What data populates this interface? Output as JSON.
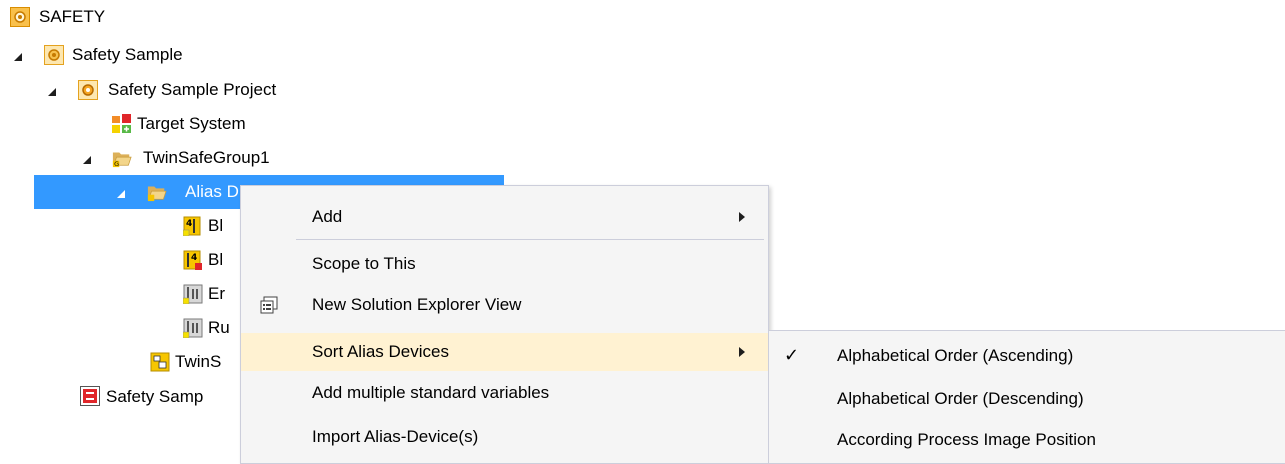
{
  "tree": {
    "root": "SAFETY",
    "safety_sample": "Safety Sample",
    "safety_sample_project": "Safety Sample Project",
    "target_system": "Target System",
    "twinsafe_group": "TwinSafeGroup1",
    "alias_devices": "Alias D",
    "child1": "Bl",
    "child2": "Bl",
    "child3": "Er",
    "child4": "Ru",
    "twins": "TwinS",
    "safety_samp": "Safety Samp"
  },
  "context_menu": {
    "add": "Add",
    "scope_to_this": "Scope to This",
    "new_solution_explorer_view": "New Solution Explorer View",
    "sort_alias_devices": "Sort Alias Devices",
    "add_multiple_standard_variables": "Add multiple standard variables",
    "import_alias_devices": "Import Alias-Device(s)"
  },
  "submenu": {
    "check_mark": "✓",
    "alphabetical_ascending": "Alphabetical Order (Ascending)",
    "alphabetical_descending": "Alphabetical Order (Descending)",
    "process_image_position": "According Process Image Position"
  },
  "colors": {
    "selection": "#3399ff",
    "menu_background": "#f5f5f5",
    "menu_highlight": "#fff2d2",
    "menu_border": "#cccedb",
    "safety_icon": "#f2a81a"
  }
}
